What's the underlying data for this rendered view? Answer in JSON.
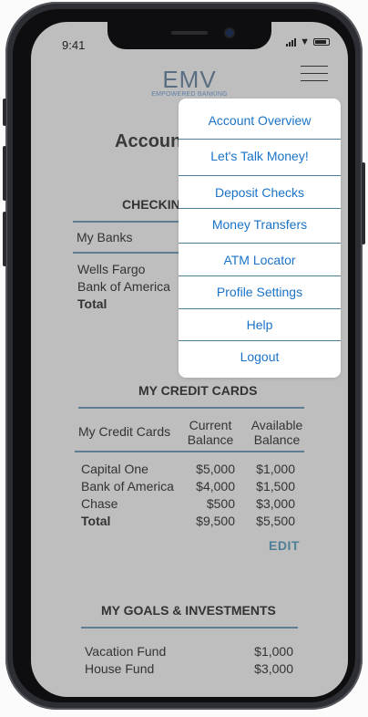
{
  "status": {
    "time": "9:41"
  },
  "logo": {
    "mark": "EMV",
    "tagline": "EMPOWERED BANKING"
  },
  "page": {
    "title": "Account"
  },
  "checking": {
    "title": "CHECKIN",
    "header": "My Banks",
    "rows": [
      "Wells Fargo",
      "Bank of America"
    ],
    "total_label": "Total"
  },
  "credit": {
    "title": "MY CREDIT CARDS",
    "col_name": "My Credit Cards",
    "col_current": [
      "Current",
      "Balance"
    ],
    "col_available": [
      "Available",
      "Balance"
    ],
    "rows": [
      {
        "name": "Capital One",
        "current": "$5,000",
        "available": "$1,000"
      },
      {
        "name": "Bank of America",
        "current": "$4,000",
        "available": "$1,500"
      },
      {
        "name": "Chase",
        "current": "$500",
        "available": "$3,000"
      }
    ],
    "total": {
      "name": "Total",
      "current": "$9,500",
      "available": "$5,500"
    },
    "edit_label": "EDIT"
  },
  "goals": {
    "title": "MY GOALS & INVESTMENTS",
    "rows": [
      {
        "name": "Vacation Fund",
        "amount": "$1,000"
      },
      {
        "name": "House Fund",
        "amount": "$3,000"
      }
    ]
  },
  "menu": {
    "items": [
      "Account Overview",
      "Let's Talk Money!",
      "Deposit Checks",
      "Money Transfers",
      "ATM Locator",
      "Profile Settings",
      "Help",
      "Logout"
    ]
  }
}
